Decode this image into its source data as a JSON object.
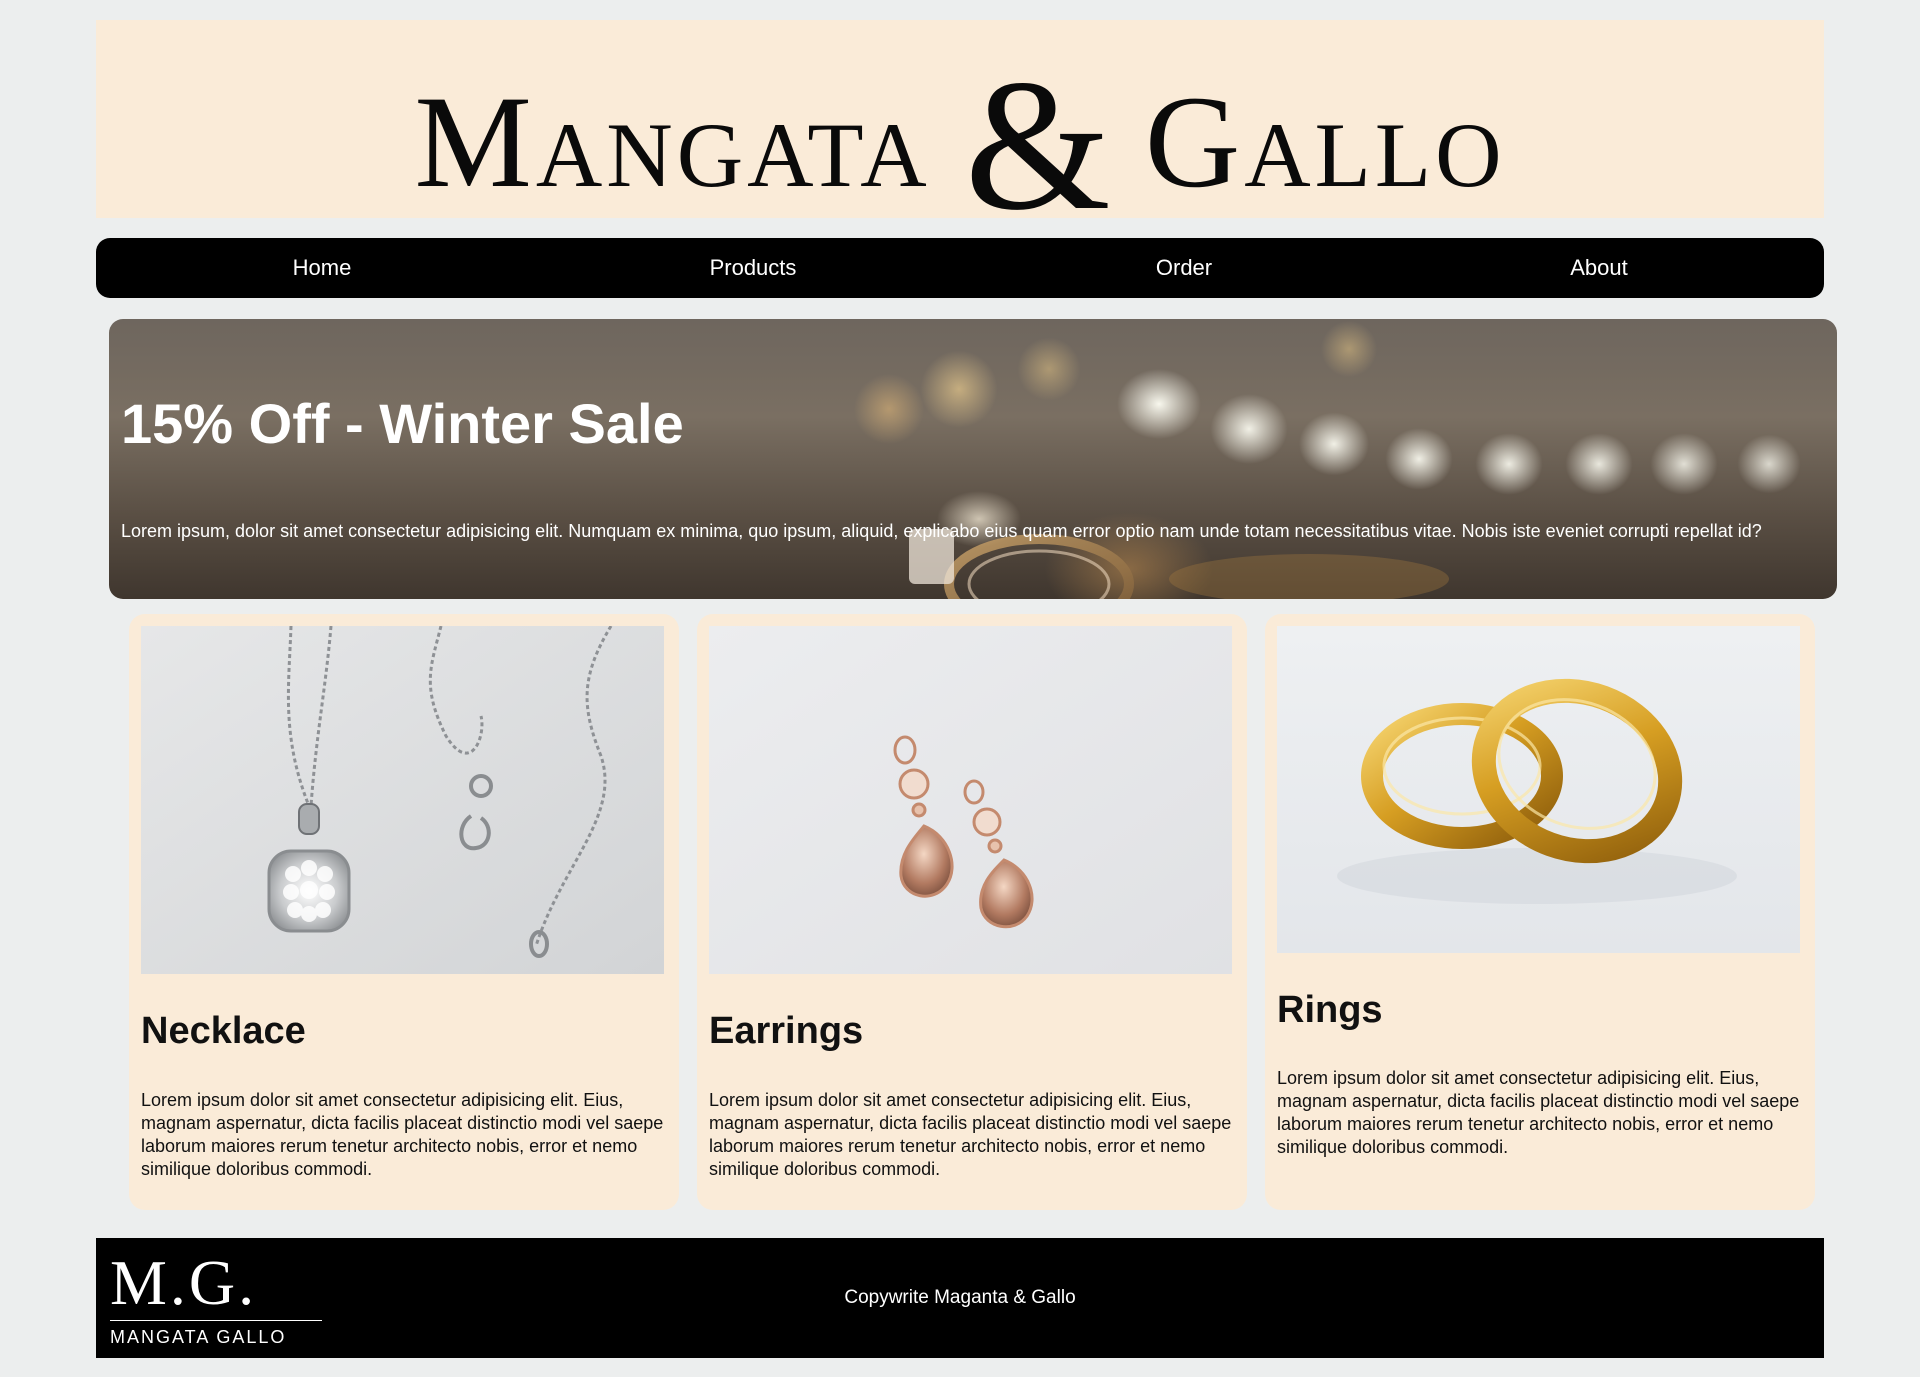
{
  "brand": {
    "word_left": "Mangata",
    "ampersand": "&",
    "word_right": "Gallo"
  },
  "nav": {
    "items": [
      {
        "label": "Home"
      },
      {
        "label": "Products"
      },
      {
        "label": "Order"
      },
      {
        "label": "About"
      }
    ]
  },
  "hero": {
    "title": "15% Off - Winter Sale",
    "text": "Lorem ipsum, dolor sit amet consectetur adipisicing elit. Numquam ex minima, quo ipsum, aliquid, explicabo eius quam error optio nam unde totam necessitatibus vitae. Nobis iste eveniet corrupti repellat id?"
  },
  "products": [
    {
      "title": "Necklace",
      "icon": "necklace-image",
      "text": "Lorem ipsum dolor sit amet consectetur adipisicing elit. Eius, magnam aspernatur, dicta facilis placeat distinctio modi vel saepe laborum maiores rerum tenetur architecto nobis, error et nemo similique doloribus commodi."
    },
    {
      "title": "Earrings",
      "icon": "earrings-image",
      "text": "Lorem ipsum dolor sit amet consectetur adipisicing elit. Eius, magnam aspernatur, dicta facilis placeat distinctio modi vel saepe laborum maiores rerum tenetur architecto nobis, error et nemo similique doloribus commodi."
    },
    {
      "title": "Rings",
      "icon": "rings-image",
      "text": "Lorem ipsum dolor sit amet consectetur adipisicing elit. Eius, magnam aspernatur, dicta facilis placeat distinctio modi vel saepe laborum maiores rerum tenetur architecto nobis, error et nemo similique doloribus commodi."
    }
  ],
  "footer": {
    "logo_mark": "M.G.",
    "logo_sub": "MANGATA GALLO",
    "copyright": "Copywrite Maganta & Gallo"
  },
  "colors": {
    "page_bg": "#eceeee",
    "cream": "#faebd8",
    "black": "#000000",
    "gold": "#d4a22c",
    "rose_gold": "#c98a6e"
  }
}
